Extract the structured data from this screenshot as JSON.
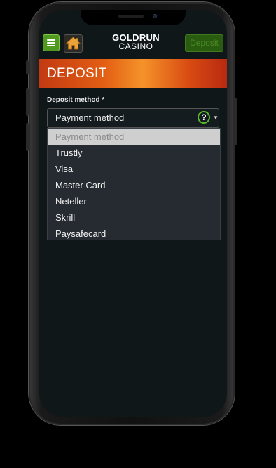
{
  "header": {
    "logo_line1": "GOLDRUN",
    "logo_line2": "CASINO",
    "deposit_button": "Deposit"
  },
  "banner": {
    "title": "DEPOSIT"
  },
  "form": {
    "label": "Deposit method *",
    "selected_value": "Payment method",
    "help_symbol": "?",
    "chevron": "⌄"
  },
  "dropdown": {
    "options": [
      "Payment method",
      "Trustly",
      "Visa",
      "Master Card",
      "Neteller",
      "Skrill",
      "Paysafecard"
    ]
  },
  "colors": {
    "accent_green": "#4f9a1f",
    "banner_orange": "#e35f14",
    "background": "#0f1719"
  }
}
